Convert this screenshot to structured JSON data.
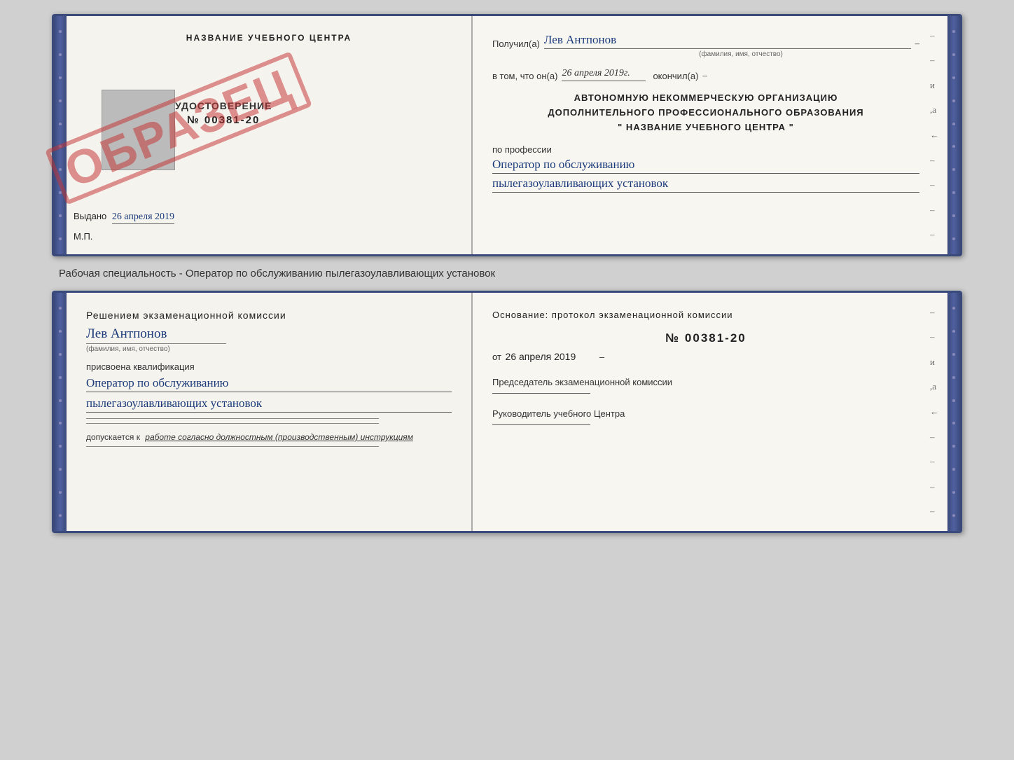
{
  "page": {
    "background": "#c8c8d0"
  },
  "subtitle": "Рабочая специальность - Оператор по обслуживанию пылегазоулавливающих установок",
  "top_book": {
    "left_page": {
      "title": "НАЗВАНИЕ УЧЕБНОГО ЦЕНТРА",
      "stamp_text": "ОБРАЗЕЦ",
      "udost_label": "УДОСТОВЕРЕНИЕ",
      "number": "№ 00381-20",
      "vydano_label": "Выдано",
      "vydano_date": "26 апреля 2019",
      "mp_label": "М.П."
    },
    "right_page": {
      "poluchil_label": "Получил(а)",
      "poluchil_value": "Лев Антпонов",
      "fio_sublabel": "(фамилия, имя, отчество)",
      "vtom_label": "в том, что он(а)",
      "vtom_date": "26 апреля 2019г.",
      "okonchil_label": "окончил(а)",
      "org_line1": "АВТОНОМНУЮ НЕКОММЕРЧЕСКУЮ ОРГАНИЗАЦИЮ",
      "org_line2": "ДОПОЛНИТЕЛЬНОГО ПРОФЕССИОНАЛЬНОГО ОБРАЗОВАНИЯ",
      "org_line3": "\"  НАЗВАНИЕ УЧЕБНОГО ЦЕНТРА  \"",
      "po_professii_label": "по профессии",
      "professiya_line1": "Оператор по обслуживанию",
      "professiya_line2": "пылегазоулавливающих установок"
    }
  },
  "bottom_book": {
    "left_page": {
      "resheniem_label": "Решением экзаменационной комиссии",
      "person_name": "Лев Антпонов",
      "fio_sublabel": "(фамилия, имя, отчество)",
      "prisvoena_label": "присвоена квалификация",
      "kvali_line1": "Оператор по обслуживанию",
      "kvali_line2": "пылегазоулавливающих установок",
      "dopusk_prefix": "допускается к",
      "dopusk_value": "работе согласно должностным (производственным) инструкциям"
    },
    "right_page": {
      "osnov_label": "Основание: протокол экзаменационной комиссии",
      "number": "№  00381-20",
      "ot_label": "от",
      "date": "26 апреля 2019",
      "predsedatel_label": "Председатель экзаменационной комиссии",
      "rukovoditel_label": "Руководитель учебного Центра"
    }
  }
}
